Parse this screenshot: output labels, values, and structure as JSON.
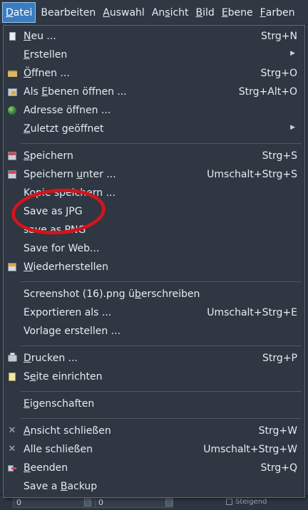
{
  "menubar": {
    "items": [
      {
        "label": "Datei",
        "mnemonic_index": 0,
        "active": true
      },
      {
        "label": "Bearbeiten",
        "mnemonic_index": -1
      },
      {
        "label": "Auswahl",
        "mnemonic_index": 0
      },
      {
        "label": "Ansicht",
        "mnemonic_index": 2
      },
      {
        "label": "Bild",
        "mnemonic_index": 0
      },
      {
        "label": "Ebene",
        "mnemonic_index": 0
      },
      {
        "label": "Farben",
        "mnemonic_index": 0
      }
    ]
  },
  "menu": {
    "groups": [
      [
        {
          "label": "Neu ...",
          "mnemonic": "N",
          "shortcut": "Strg+N",
          "icon": "new-document-icon"
        },
        {
          "label": "Erstellen",
          "mnemonic": "E",
          "submenu": true
        },
        {
          "label": "Öffnen ...",
          "mnemonic": "Ö",
          "shortcut": "Strg+O",
          "icon": "folder-open-icon"
        },
        {
          "label": "Als Ebenen öffnen ...",
          "mnemonic": "E",
          "shortcut": "Strg+Alt+O",
          "icon": "open-as-layers-icon"
        },
        {
          "label": "Adresse öffnen ...",
          "icon": "globe-icon"
        },
        {
          "label": "Zuletzt geöffnet",
          "mnemonic": "Z",
          "submenu": true
        }
      ],
      [
        {
          "label": "Speichern",
          "mnemonic": "S",
          "shortcut": "Strg+S",
          "icon": "save-icon"
        },
        {
          "label": "Speichern unter ...",
          "mnemonic": "u",
          "shortcut": "Umschalt+Strg+S",
          "icon": "save-as-icon"
        },
        {
          "label": "Kopie speichern ..."
        },
        {
          "label": "Save as JPG"
        },
        {
          "label": "save as PNG"
        },
        {
          "label": "Save for Web..."
        },
        {
          "label": "Wiederherstellen",
          "mnemonic": "W",
          "icon": "revert-icon"
        }
      ],
      [
        {
          "label": "Screenshot (16).png überschreiben",
          "mnemonic": "b"
        },
        {
          "label": "Exportieren als ...",
          "shortcut": "Umschalt+Strg+E"
        },
        {
          "label": "Vorlage erstellen ..."
        }
      ],
      [
        {
          "label": "Drucken ...",
          "mnemonic": "D",
          "shortcut": "Strg+P",
          "icon": "print-icon"
        },
        {
          "label": "Seite einrichten",
          "mnemonic": "e",
          "icon": "page-setup-icon"
        }
      ],
      [
        {
          "label": "Eigenschaften",
          "mnemonic": "E"
        }
      ],
      [
        {
          "label": "Ansicht schließen",
          "mnemonic": "A",
          "shortcut": "Strg+W",
          "icon": "close-view-icon"
        },
        {
          "label": "Alle schließen",
          "shortcut": "Umschalt+Strg+W",
          "icon": "close-all-icon"
        },
        {
          "label": "Beenden",
          "mnemonic": "B",
          "shortcut": "Strg+Q",
          "icon": "quit-icon"
        },
        {
          "label": "Save a Backup",
          "mnemonic": "B"
        }
      ]
    ]
  },
  "background": {
    "field_left_value": "0",
    "field_mid_value": "0",
    "checkbox_label": "Steigend"
  },
  "colors": {
    "menubar_active": "#3a7cc0",
    "menu_bg": "#2e3742",
    "annotation": "#d2141c"
  }
}
